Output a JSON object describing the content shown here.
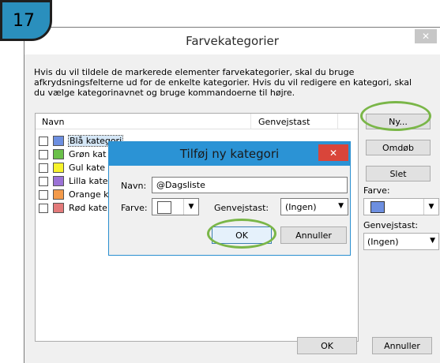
{
  "step_number": "17",
  "main_dialog": {
    "title": "Farvekategorier",
    "intro": "Hvis du vil tildele de markerede elementer farvekategorier, skal du bruge afkrydsningsfelterne ud for de enkelte kategorier. Hvis du vil redigere en kategori, skal du vælge kategorinavnet og bruge kommandoerne til højre.",
    "columns": {
      "name": "Navn",
      "shortcut": "Genvejstast"
    },
    "categories": [
      {
        "label": "Blå kategori",
        "color": "#6d8fe0"
      },
      {
        "label": "Grøn kat",
        "color": "#6ac04a"
      },
      {
        "label": "Gul kate",
        "color": "#f7f32b"
      },
      {
        "label": "Lilla kate",
        "color": "#9b72d6"
      },
      {
        "label": "Orange k",
        "color": "#f39a4a"
      },
      {
        "label": "Rød kate",
        "color": "#e37a7a"
      }
    ],
    "buttons": {
      "new": "Ny...",
      "rename": "Omdøb",
      "delete": "Slet",
      "ok": "OK",
      "cancel": "Annuller"
    },
    "color_label": "Farve:",
    "color_value": "#6d8fe0",
    "shortcut_label": "Genvejstast:",
    "shortcut_value": "(Ingen)",
    "close_glyph": "✕"
  },
  "sub_dialog": {
    "title": "Tilføj ny kategori",
    "name_label": "Navn:",
    "name_value": "@Dagsliste",
    "color_label": "Farve:",
    "shortcut_label": "Genvejstast:",
    "shortcut_value": "(Ingen)",
    "ok": "OK",
    "cancel": "Annuller",
    "close_glyph": "✕"
  },
  "colors": {
    "accent_blue": "#2b93d5",
    "highlight_green": "#7ab648",
    "close_red": "#d9453a"
  },
  "icons": {
    "dropdown": "chevron-down-icon",
    "close": "close-icon"
  },
  "glyphs": {
    "dropdown": "▼"
  }
}
